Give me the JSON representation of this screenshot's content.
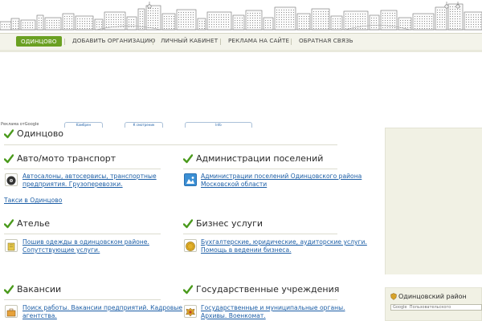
{
  "nav": {
    "items": [
      {
        "label": "ОДИНЦОВО",
        "active": true
      },
      {
        "label": "ДОБАВИТЬ ОРГАНИЗАЦИЮ"
      },
      {
        "label": "ЛИЧНЫЙ КАБИНЕТ"
      },
      {
        "label": "РЕКЛАМА НА САЙТЕ"
      },
      {
        "label": "ОБРАТНАЯ СВЯЗЬ"
      }
    ]
  },
  "ad": {
    "label": "Реклама отGoogle",
    "tabs": [
      "Kамбрен",
      "К смотреник",
      "lnfо"
    ]
  },
  "sections": {
    "odintsovo": {
      "title": "Одинцово"
    },
    "auto": {
      "title": "Авто/мото транспорт",
      "lines": [
        "Автосалоны, автосервисы, транспортные",
        "предприятия. Грузоперевозки."
      ],
      "extra": "Такси в Одинцово",
      "icon": "wheel-icon"
    },
    "admin": {
      "title": "Администрации поселений",
      "lines": [
        "Администрации поселений Одинцовского района",
        "Московской области"
      ],
      "icon": "admin-emblem-icon"
    },
    "atelier": {
      "title": "Ателье",
      "lines": [
        "Пошив одежды в одинцовском районе.",
        "Сопутствующие услуги."
      ],
      "icon": "sewing-icon"
    },
    "business": {
      "title": "Бизнес услуги",
      "lines": [
        "Бухгалтерские, юридические, аудиторские услуги.",
        "Помощь в ведении бизнеса."
      ],
      "icon": "coin-icon"
    },
    "jobs": {
      "title": "Вакансии",
      "lines": [
        "Поиск работы. Вакансии предприятий. Кадровые",
        "агентства."
      ],
      "icon": "briefcase-icon"
    },
    "gov": {
      "title": "Государственные учреждения",
      "lines": [
        "Государственные и муниципальные органы.",
        "Архивы. Военкомат."
      ],
      "icon": "coat-of-arms-icon"
    }
  },
  "sidebar": {
    "region_title": "Одинцовский район",
    "search_placeholder": "Google  Пользовательского"
  },
  "colors": {
    "accent": "#6aa022",
    "link": "#1c5ea6",
    "check": "#4a9a1c"
  }
}
